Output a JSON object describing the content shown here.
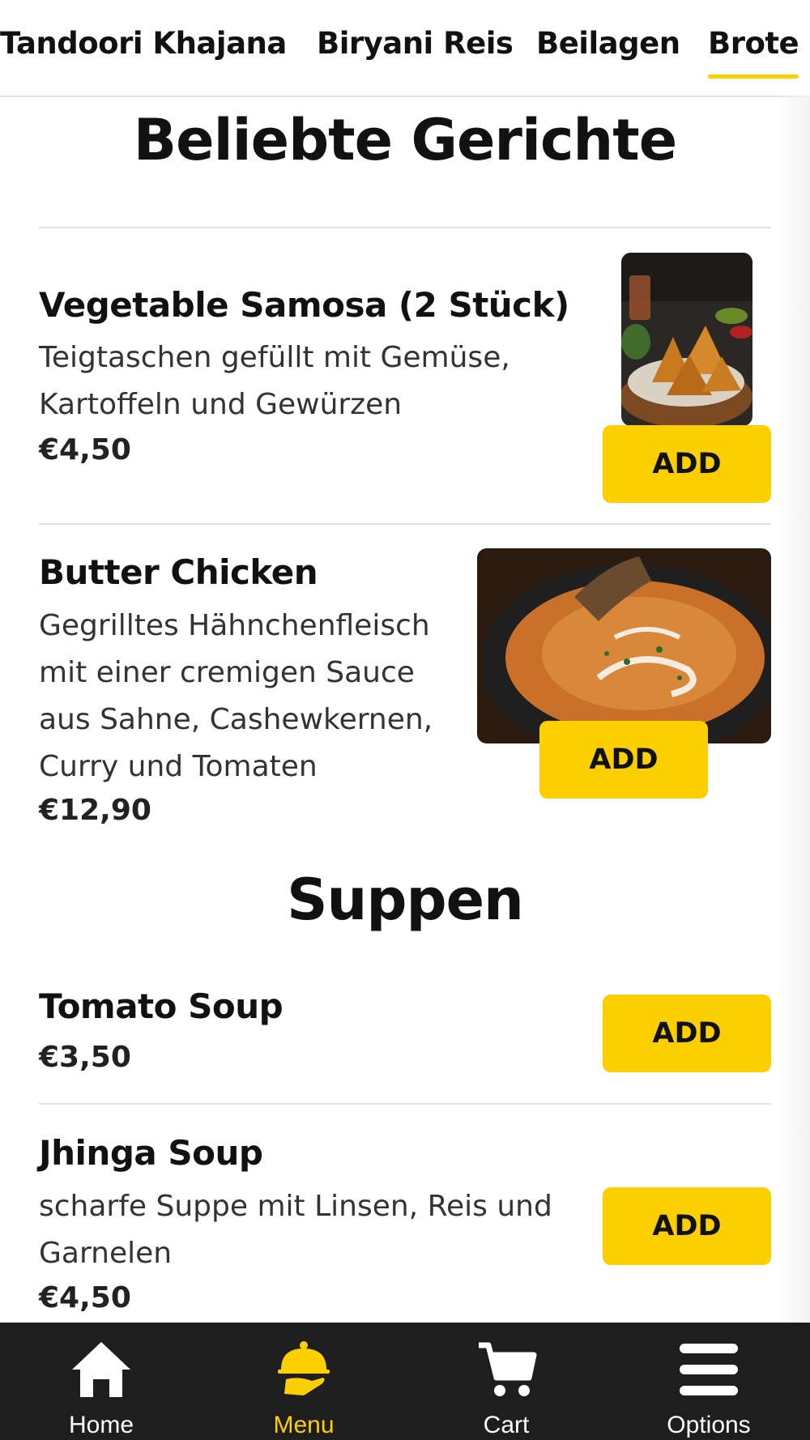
{
  "colors": {
    "accent": "#fccf00",
    "nav_bg": "#1e1e1e"
  },
  "categories": [
    {
      "label": "Tandoori Khajana"
    },
    {
      "label": "Biryani Reis"
    },
    {
      "label": "Beilagen"
    },
    {
      "label": "Brote",
      "active": true
    }
  ],
  "sections": [
    {
      "title": "Beliebte Gerichte",
      "items": [
        {
          "name": "Vegetable Samosa (2 Stück)",
          "description": "Teigtaschen gefüllt mit Gemüse, Kartoffeln und Gewürzen",
          "price": "€4,50",
          "button": "ADD",
          "image": "samosa-photo"
        },
        {
          "name": "Butter Chicken",
          "description": "Gegrilltes Hähnchenfleisch mit einer cremigen Sauce aus Sahne, Cashewkernen, Curry und Tomaten",
          "price": "€12,90",
          "button": "ADD",
          "image": "butter-chicken-photo"
        }
      ]
    },
    {
      "title": "Suppen",
      "items": [
        {
          "name": "Tomato Soup",
          "price": "€3,50",
          "button": "ADD"
        },
        {
          "name": "Jhinga Soup",
          "description": "scharfe Suppe mit Linsen, Reis und Garnelen",
          "price": "€4,50",
          "button": "ADD"
        }
      ]
    }
  ],
  "bottom_nav": [
    {
      "label": "Home",
      "icon": "home-icon"
    },
    {
      "label": "Menu",
      "icon": "cloche-icon",
      "active": true
    },
    {
      "label": "Cart",
      "icon": "cart-icon"
    },
    {
      "label": "Options",
      "icon": "hamburger-menu-icon"
    }
  ]
}
